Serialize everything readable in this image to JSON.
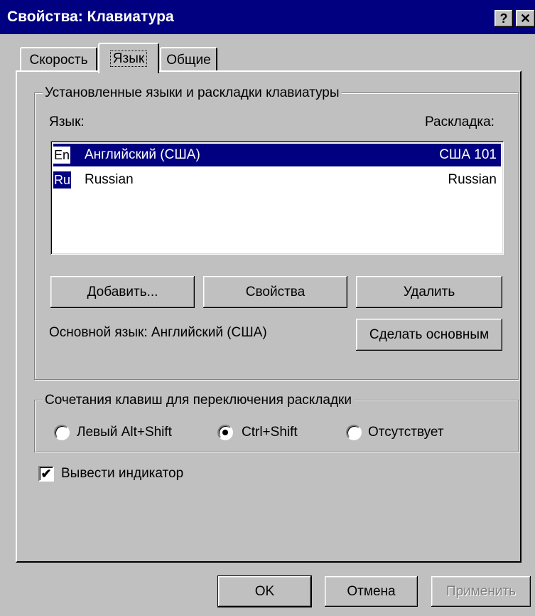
{
  "window": {
    "title": "Свойства: Клавиатура",
    "help_label": "?",
    "close_label": "✕"
  },
  "tabs": [
    {
      "label": "Скорость",
      "active": false
    },
    {
      "label": "Язык",
      "active": true
    },
    {
      "label": "Общие",
      "active": false
    }
  ],
  "languages_group": {
    "legend": "Установленные языки и раскладки клавиатуры",
    "col_language": "Язык:",
    "col_layout": "Раскладка:",
    "rows": [
      {
        "badge": "En",
        "language": "Английский (США)",
        "layout": "США 101",
        "selected": true
      },
      {
        "badge": "Ru",
        "language": "Russian",
        "layout": "Russian",
        "selected": false
      }
    ],
    "add_label": "Добавить...",
    "properties_label": "Свойства",
    "remove_label": "Удалить",
    "default_language_text": "Основной язык:  Английский (США)",
    "set_default_label": "Сделать основным"
  },
  "switch_group": {
    "legend": "Сочетания клавиш для переключения раскладки",
    "options": [
      {
        "label": "Левый Alt+Shift",
        "checked": false
      },
      {
        "label": "Ctrl+Shift",
        "checked": true
      },
      {
        "label": "Отсутствует",
        "checked": false
      }
    ]
  },
  "indicator": {
    "label": "Вывести индикатор",
    "checked": true,
    "check_glyph": "✔"
  },
  "footer": {
    "ok_label": "OK",
    "cancel_label": "Отмена",
    "apply_label": "Применить"
  }
}
